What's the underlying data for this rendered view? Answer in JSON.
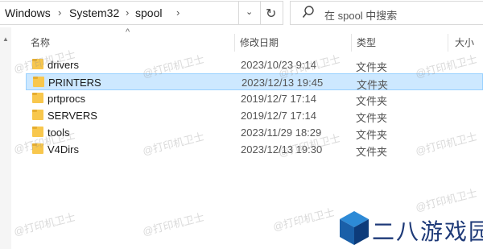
{
  "address": {
    "crumbs": [
      "Windows",
      "System32",
      "spool"
    ],
    "separator": "›",
    "dropdown_glyph": "⌄",
    "refresh_glyph": "↻"
  },
  "search": {
    "placeholder": "在 spool 中搜索"
  },
  "columns": {
    "name": "名称",
    "date": "修改日期",
    "type": "类型",
    "size": "大小",
    "sort": "^"
  },
  "rows": [
    {
      "name": "drivers",
      "date": "2023/10/23 9:14",
      "type": "文件夹",
      "selected": false
    },
    {
      "name": "PRINTERS",
      "date": "2023/12/13 19:45",
      "type": "文件夹",
      "selected": true
    },
    {
      "name": "prtprocs",
      "date": "2019/12/7 17:14",
      "type": "文件夹",
      "selected": false
    },
    {
      "name": "SERVERS",
      "date": "2019/12/7 17:14",
      "type": "文件夹",
      "selected": false
    },
    {
      "name": "tools",
      "date": "2023/11/29 18:29",
      "type": "文件夹",
      "selected": false
    },
    {
      "name": "V4Dirs",
      "date": "2023/12/13 19:30",
      "type": "文件夹",
      "selected": false
    }
  ],
  "watermark": "@打印机卫士",
  "logo": {
    "text": "二八游戏园"
  },
  "icons": {
    "folder": "folder-icon",
    "search": "search-icon",
    "refresh": "refresh-icon"
  },
  "colors": {
    "selection_bg": "#cde8ff",
    "selection_border": "#99d1ff",
    "folder": "#f8c74d"
  }
}
